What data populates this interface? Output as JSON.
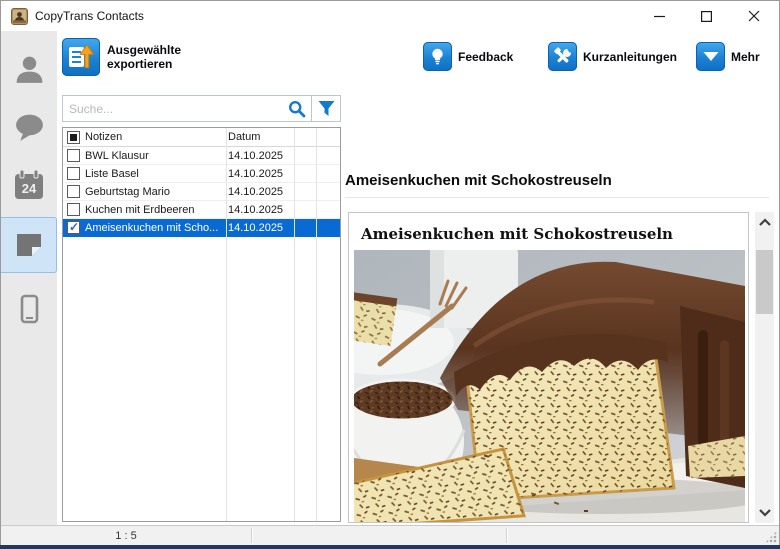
{
  "window": {
    "title": "CopyTrans Contacts"
  },
  "sidebar": {
    "items": [
      {
        "id": "contacts",
        "icon": "person-icon",
        "selected": false
      },
      {
        "id": "messages",
        "icon": "chat-icon",
        "selected": false
      },
      {
        "id": "calendar",
        "icon": "calendar-icon",
        "badge": "24",
        "selected": false
      },
      {
        "id": "notes",
        "icon": "note-icon",
        "selected": true
      },
      {
        "id": "device",
        "icon": "phone-icon",
        "selected": false
      }
    ]
  },
  "toolbar": {
    "export_line1": "Ausgewählte",
    "export_line2": "exportieren",
    "feedback_label": "Feedback",
    "guides_label": "Kurzanleitungen",
    "more_label": "Mehr"
  },
  "search": {
    "placeholder": "Suche..."
  },
  "notes_table": {
    "columns": {
      "title": "Notizen",
      "date": "Datum"
    },
    "rows": [
      {
        "title": "BWL Klausur",
        "date": "14.10.2025",
        "checked": false,
        "selected": false
      },
      {
        "title": "Liste Basel",
        "date": "14.10.2025",
        "checked": false,
        "selected": false
      },
      {
        "title": "Geburtstag Mario",
        "date": "14.10.2025",
        "checked": false,
        "selected": false
      },
      {
        "title": "Kuchen mit Erdbeeren",
        "date": "14.10.2025",
        "checked": false,
        "selected": false
      },
      {
        "title": "Ameisenkuchen mit Scho...",
        "date": "14.10.2025",
        "checked": true,
        "selected": true
      }
    ]
  },
  "detail": {
    "heading": "Ameisenkuchen mit Schokostreuseln",
    "document_title": "Ameisenkuchen mit Schokostreuseln",
    "photo_description": "chocolate-glazed ant cake loaf"
  },
  "statusbar": {
    "selection": "1 : 5"
  },
  "colors": {
    "accent_blue": "#1479d0",
    "selection_blue": "#0a6ad4",
    "sidebar_selected_bg": "#cfe5f7",
    "orange_arrow": "#f6a21d"
  }
}
